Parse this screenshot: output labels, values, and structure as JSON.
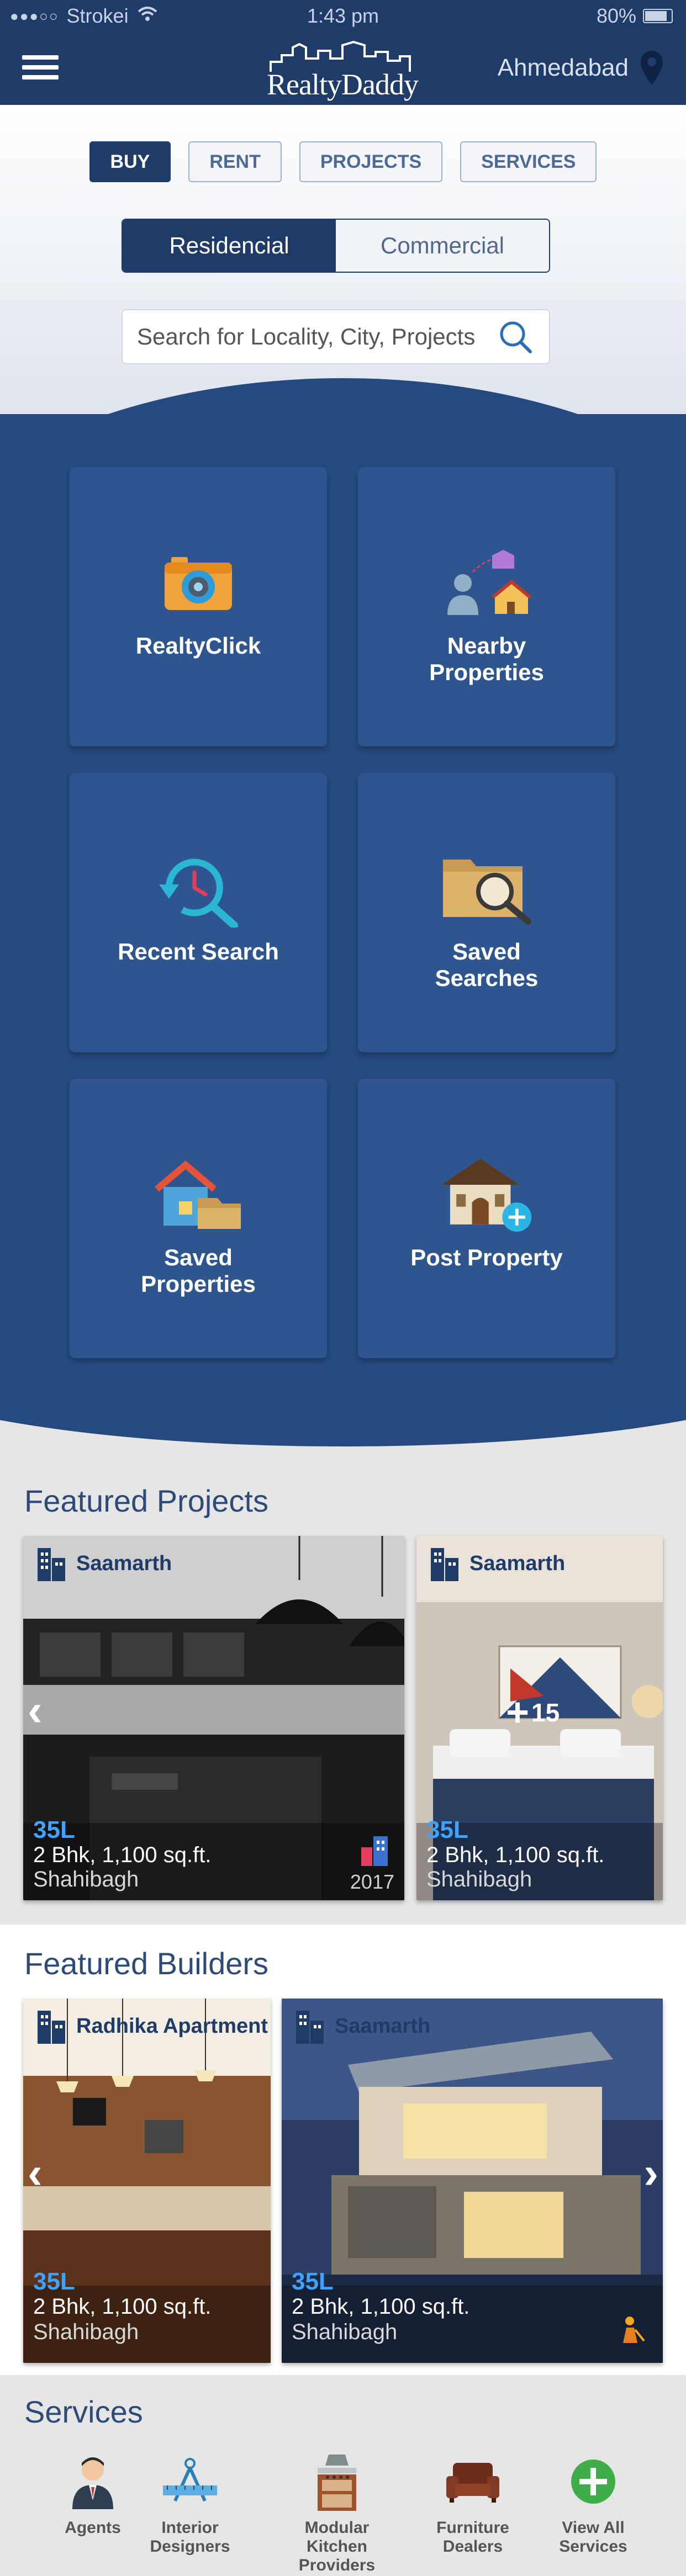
{
  "status_bar": {
    "carrier": "Strokei",
    "time": "1:43 pm",
    "battery": "80%"
  },
  "header": {
    "logo_text": "RealtyDaddy",
    "city": "Ahmedabad"
  },
  "tabs": [
    {
      "label": "BUY",
      "active": true
    },
    {
      "label": "RENT",
      "active": false
    },
    {
      "label": "PROJECTS",
      "active": false
    },
    {
      "label": "SERVICES",
      "active": false
    }
  ],
  "segment": {
    "left": "Residencial",
    "right": "Commercial",
    "selected": "Residencial"
  },
  "search": {
    "placeholder": "Search for Locality, City, Projects"
  },
  "tiles": [
    {
      "label": "RealtyClick",
      "icon": "camera-icon"
    },
    {
      "label": "Nearby Properties",
      "icon": "nearby-properties-icon"
    },
    {
      "label": "Recent Search",
      "icon": "recent-search-icon"
    },
    {
      "label": "Saved Searches",
      "icon": "saved-searches-icon"
    },
    {
      "label": "Saved Properties",
      "icon": "saved-properties-icon"
    },
    {
      "label": "Post Property",
      "icon": "post-property-icon"
    }
  ],
  "featured_projects": {
    "title": "Featured Projects",
    "cards": [
      {
        "builder": "Saamarth",
        "price": "35L",
        "details": "2 Bhk, 1,100 sq.ft.",
        "location": "Shahibagh",
        "year": "2017"
      },
      {
        "builder": "Saamarth",
        "price": "35L",
        "details": "2 Bhk, 1,100 sq.ft.",
        "location": "Shahibagh",
        "more_photos": "15"
      }
    ]
  },
  "featured_builders": {
    "title": "Featured Builders",
    "cards": [
      {
        "builder": "Radhika Apartment",
        "price": "35L",
        "details": "2 Bhk, 1,100 sq.ft.",
        "location": "Shahibagh"
      },
      {
        "builder": "Saamarth",
        "price": "35L",
        "details": "2 Bhk, 1,100 sq.ft.",
        "location": "Shahibagh"
      }
    ]
  },
  "services": {
    "title": "Services",
    "items": [
      {
        "label": "Agents",
        "icon": "agent-icon"
      },
      {
        "label": "Interior Designers",
        "icon": "interior-designer-icon"
      },
      {
        "label": "Modular Kitchen Providers",
        "icon": "kitchen-icon"
      },
      {
        "label": "Furniture Dealers",
        "icon": "furniture-icon"
      },
      {
        "label": "View All Services",
        "icon": "plus-circle-icon"
      }
    ]
  },
  "colors": {
    "navy": "#1f3b68",
    "tile_blue": "#2e558e",
    "price_blue": "#3fa2ff"
  }
}
